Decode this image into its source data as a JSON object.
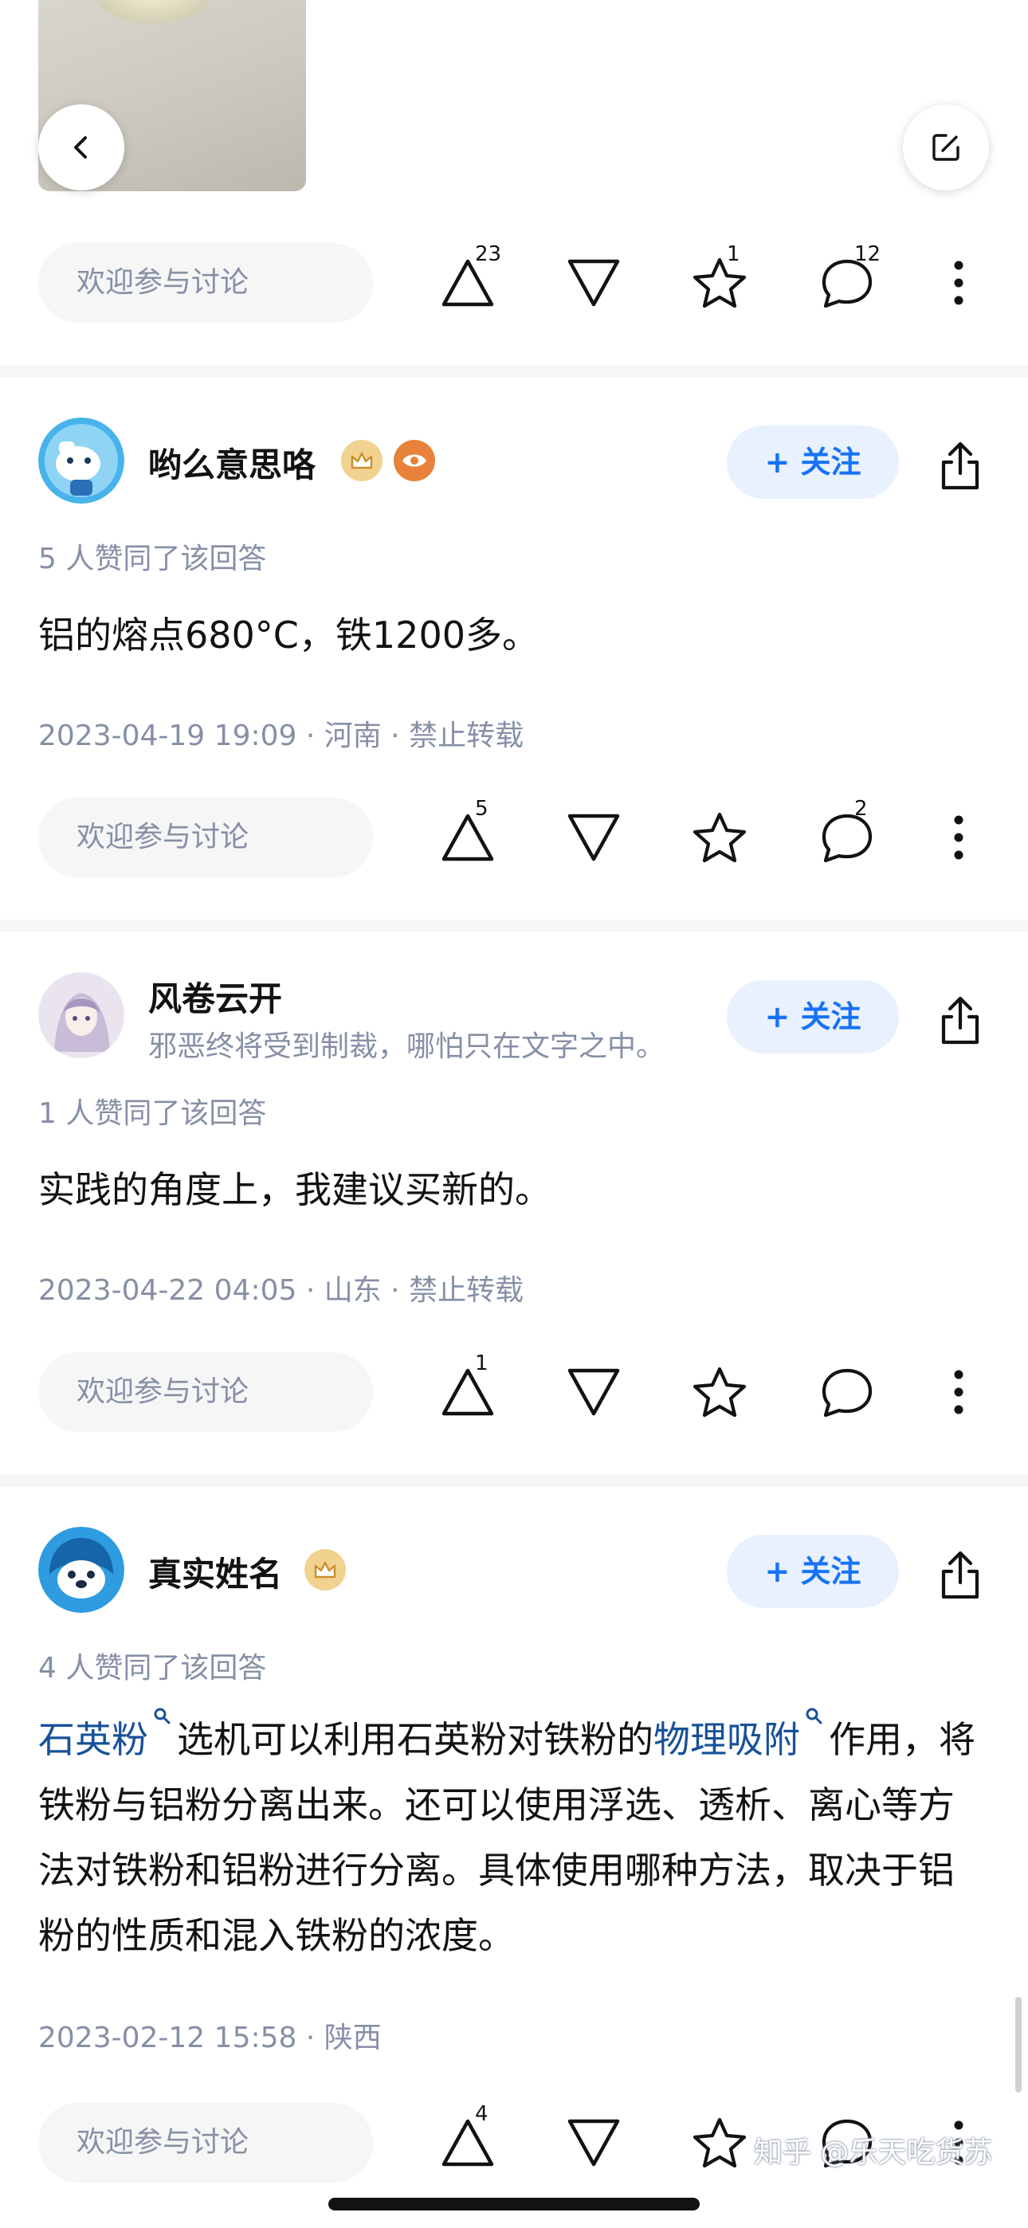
{
  "common": {
    "discuss_placeholder": "欢迎参与讨论",
    "follow_label": "+ 关注"
  },
  "top_answer": {
    "upvotes": "23",
    "favorites": "1",
    "comments": "12"
  },
  "answers": [
    {
      "author": "哟么意思咯",
      "likes_text": "5 人赞同了该回答",
      "content": "铝的熔点680°C，铁1200多。",
      "meta": "2023-04-19 19:09 · 河南 · 禁止转载",
      "upvotes": "5",
      "comments": "2"
    },
    {
      "author": "风卷云开",
      "signature": "邪恶终将受到制裁，哪怕只在文字之中。",
      "likes_text": "1 人赞同了该回答",
      "content": "实践的角度上，我建议买新的。",
      "meta": "2023-04-22 04:05 · 山东 · 禁止转载",
      "upvotes": "1"
    },
    {
      "author": "真实姓名",
      "likes_text": "4 人赞同了该回答",
      "content_kw1": "石英粉",
      "content_mid": "选机可以利用石英粉对铁粉的",
      "content_kw2": "物理吸附",
      "content_rest": "作用，将铁粉与铝粉分离出来。还可以使用浮选、透析、离心等方法对铁粉和铝粉进行分离。具体使用哪种方法，取决于铝粉的性质和混入铁粉的浓度。",
      "meta": "2023-02-12 15:58 · 陕西",
      "upvotes": "4"
    }
  ],
  "watermark": "知乎 @乐天吃货苏",
  "colors": {
    "accent": "#1772f6",
    "follow_bg": "#e8f1fd",
    "keyword": "#175199",
    "muted": "#8590a6",
    "badge_gold": "#d9a441",
    "badge_orange": "#e8823a"
  }
}
